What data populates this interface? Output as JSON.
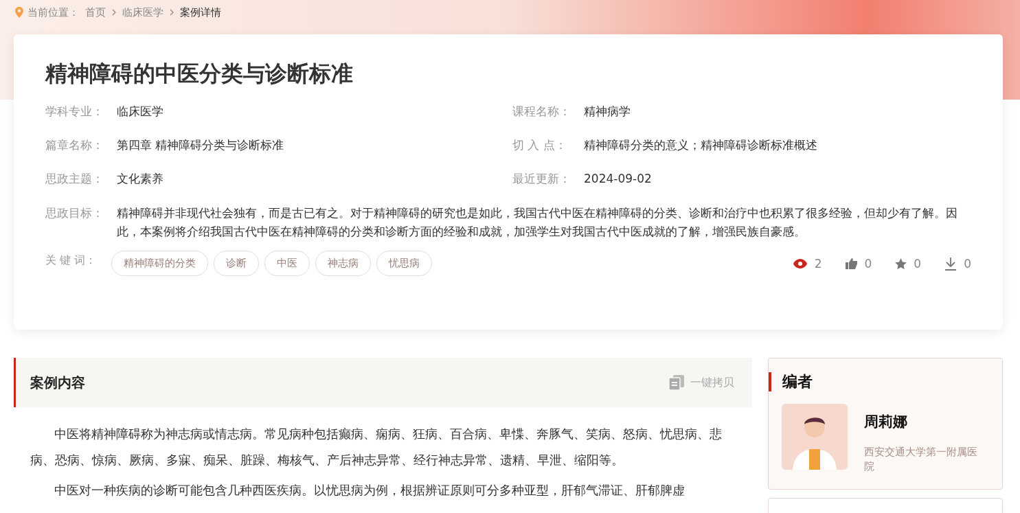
{
  "breadcrumb": {
    "label": "当前位置：",
    "items": [
      {
        "text": "首页",
        "current": false
      },
      {
        "text": "临床医学",
        "current": false
      },
      {
        "text": "案例详情",
        "current": true
      }
    ]
  },
  "case": {
    "title": "精神障碍的中医分类与诊断标准",
    "fields": [
      {
        "label": "学科专业：",
        "value": "临床医学"
      },
      {
        "label": "课程名称：",
        "value": "精神病学"
      },
      {
        "label": "篇章名称：",
        "value": "第四章 精神障碍分类与诊断标准"
      },
      {
        "label": "切 入 点：",
        "value": "精神障碍分类的意义；精神障碍诊断标准概述"
      },
      {
        "label": "思政主题：",
        "value": "文化素养"
      },
      {
        "label": "最近更新：",
        "value": "2024-09-02"
      }
    ],
    "goal": {
      "label": "思政目标：",
      "value": "精神障碍并非现代社会独有，而是古已有之。对于精神障碍的研究也是如此，我国古代中医在精神障碍的分类、诊断和治疗中也积累了很多经验，但却少有了解。因此，本案例将介绍我国古代中医在精神障碍的分类和诊断方面的经验和成就，加强学生对我国古代中医成就的了解，增强民族自豪感。"
    },
    "keywords_label": "关 键 词：",
    "keywords": [
      "精神障碍的分类",
      "诊断",
      "中医",
      "神志病",
      "忧思病"
    ],
    "stats": [
      {
        "kind": "views",
        "count": "2"
      },
      {
        "kind": "likes",
        "count": "0"
      },
      {
        "kind": "favorites",
        "count": "0"
      },
      {
        "kind": "downloads",
        "count": "0"
      }
    ]
  },
  "content": {
    "title": "案例内容",
    "copy_button": "一键拷贝",
    "paragraphs": [
      "中医将精神障碍称为神志病或情志病。常见病种包括癫病、痫病、狂病、百合病、卑惵、奔豚气、笑病、怒病、忧思病、悲病、恐病、惊病、厥病、多寐、痴呆、脏躁、梅核气、产后神志异常、经行神志异常、遗精、早泄、缩阳等。",
      "中医对一种疾病的诊断可能包含几种西医疾病。以忧思病为例，根据辨证原则可分多种亚型，肝郁气滞证、肝郁脾虚"
    ]
  },
  "author": {
    "heading": "编者",
    "name": "周莉娜",
    "affiliation": "西安交通大学第一附属医院"
  }
}
